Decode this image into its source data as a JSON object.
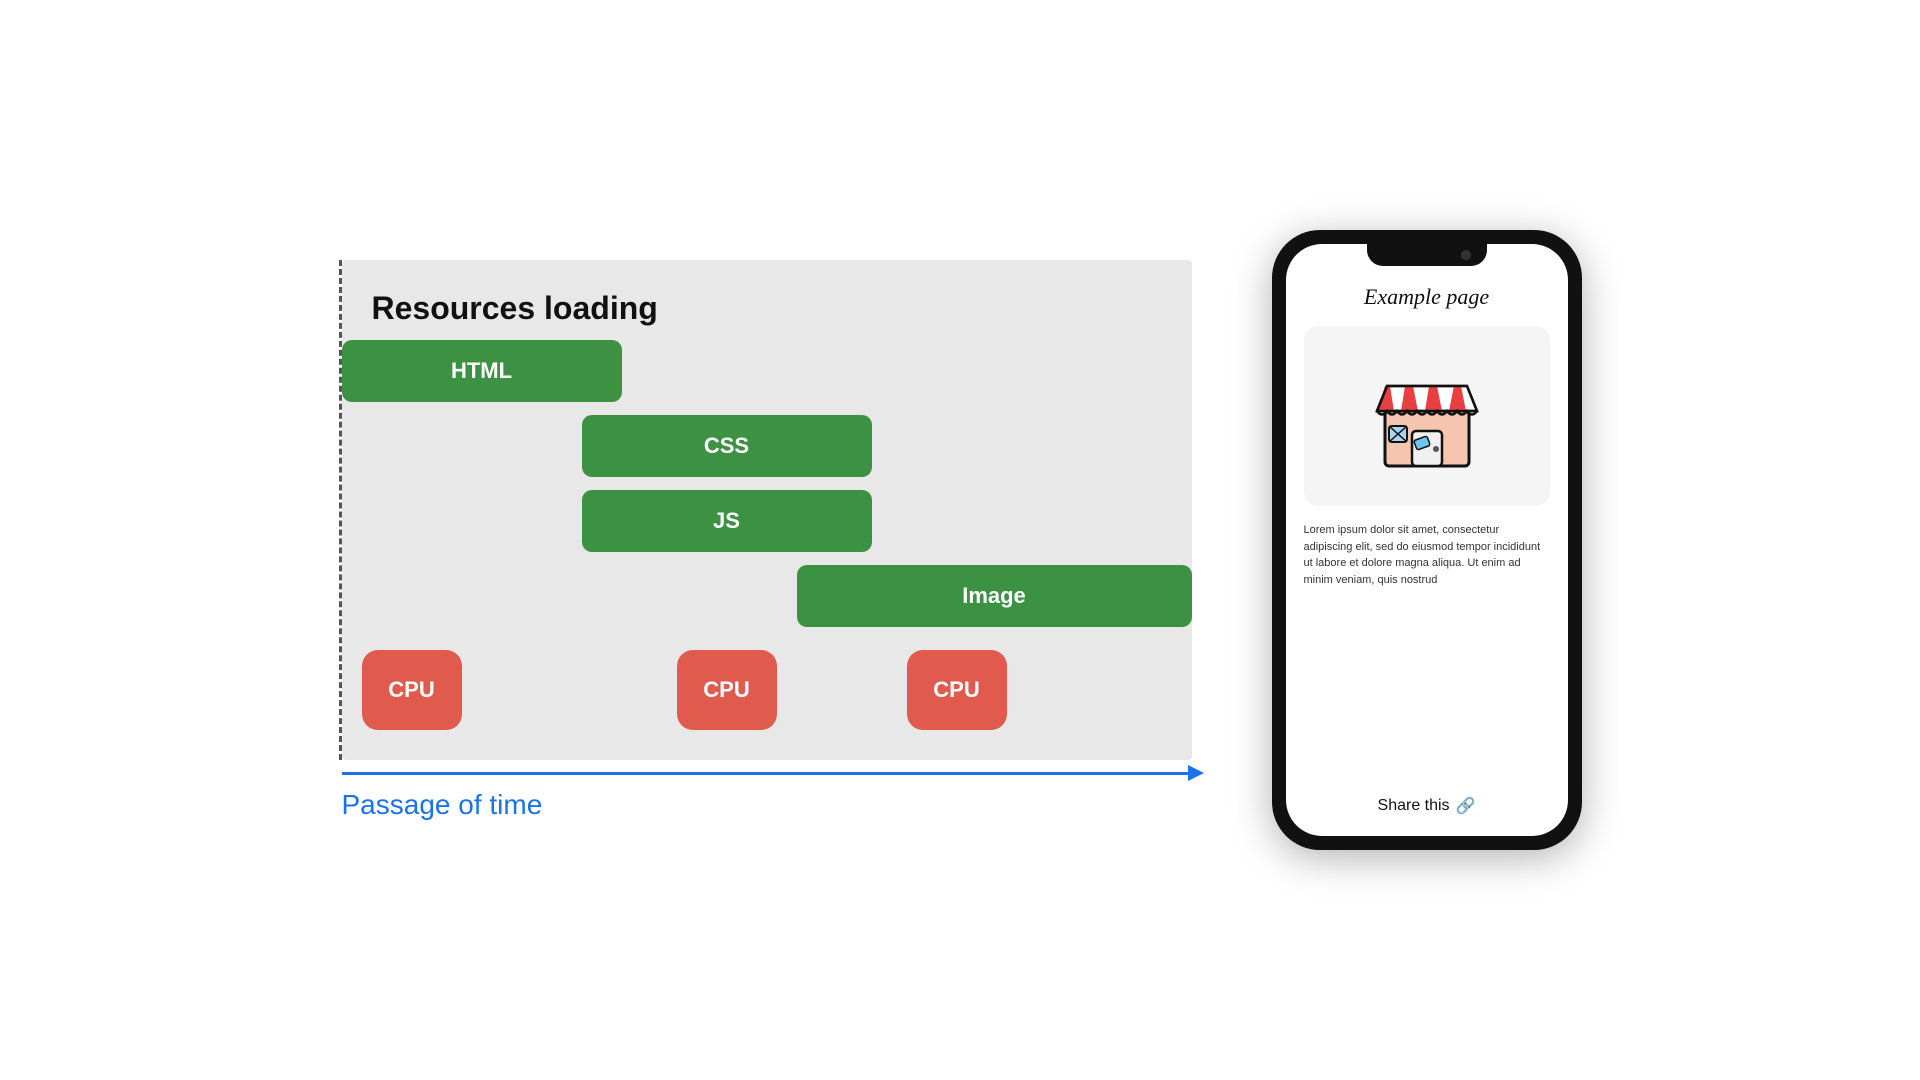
{
  "diagram": {
    "title": "Resources loading",
    "bars": [
      {
        "id": "html",
        "label": "HTML"
      },
      {
        "id": "css",
        "label": "CSS"
      },
      {
        "id": "js",
        "label": "JS"
      },
      {
        "id": "image",
        "label": "Image"
      }
    ],
    "cpu_blocks": [
      {
        "id": "cpu1",
        "label": "CPU"
      },
      {
        "id": "cpu2",
        "label": "CPU"
      },
      {
        "id": "cpu3",
        "label": "CPU"
      }
    ],
    "time_axis_label": "Passage of time"
  },
  "phone": {
    "page_title": "Example page",
    "body_text": "Lorem ipsum dolor sit amet, consectetur adipiscing elit, sed do eiusmod tempor incididunt ut labore et dolore magna aliqua. Ut enim ad minim veniam, quis nostrud",
    "share_label": "Share this"
  }
}
